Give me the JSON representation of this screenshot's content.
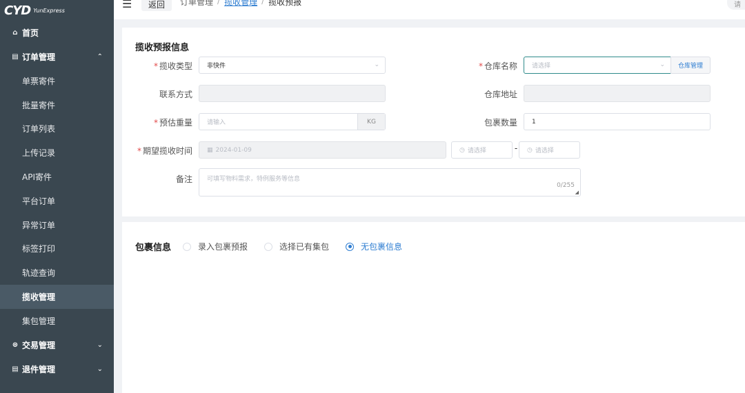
{
  "brand": {
    "logo_mark": "CYD",
    "logo_text": "YunExpress"
  },
  "sidebar": {
    "groups": [
      {
        "label": "首页",
        "icon": "home-icon",
        "glyph": "⌂"
      },
      {
        "label": "订单管理",
        "icon": "order-icon",
        "glyph": "▤",
        "chevron": "⌃"
      },
      {
        "label": "交易管理",
        "icon": "trade-icon",
        "glyph": "⊛",
        "chevron": "⌄"
      },
      {
        "label": "退件管理",
        "icon": "return-icon",
        "glyph": "▤",
        "chevron": "⌄"
      }
    ],
    "items": [
      {
        "label": "单票寄件"
      },
      {
        "label": "批量寄件"
      },
      {
        "label": "订单列表"
      },
      {
        "label": "上传记录"
      },
      {
        "label": "API寄件"
      },
      {
        "label": "平台订单"
      },
      {
        "label": "异常订单"
      },
      {
        "label": "标签打印"
      },
      {
        "label": "轨迹查询"
      },
      {
        "label": "揽收管理",
        "active": true
      },
      {
        "label": "集包管理"
      }
    ]
  },
  "header": {
    "back_label": "返回",
    "breadcrumb": [
      "订单管理",
      "揽收管理",
      "揽收预报"
    ],
    "separator": "/",
    "top_right": "请"
  },
  "pickup_section": {
    "title": "揽收预报信息",
    "required_mark": "*",
    "pickup_type": {
      "label": "揽收类型",
      "value": "非快件"
    },
    "warehouse": {
      "label": "仓库名称",
      "placeholder": "请选择",
      "manage_label": "仓库管理"
    },
    "contact": {
      "label": "联系方式",
      "value": ""
    },
    "warehouse_address": {
      "label": "仓库地址",
      "value": ""
    },
    "weight": {
      "label": "预估重量",
      "placeholder": "请输入",
      "unit": "KG"
    },
    "package_count": {
      "label": "包裹数量",
      "value": "1"
    },
    "pickup_time": {
      "label": "期望揽收时间",
      "date": "2024-01-09",
      "start_placeholder": "请选择",
      "end_placeholder": "请选择",
      "range_sep": "-"
    },
    "remark": {
      "label": "备注",
      "placeholder": "可填写物料需求，特例服务等信息",
      "counter": "0/255"
    }
  },
  "package_section": {
    "title": "包裹信息",
    "options": [
      {
        "label": "录入包裹预报",
        "checked": false
      },
      {
        "label": "选择已有集包",
        "checked": false
      },
      {
        "label": "无包裹信息",
        "checked": true
      }
    ]
  },
  "colors": {
    "sidebar_bg": "#3a4750",
    "accent": "#2e7dd1",
    "required": "#e24b4b"
  }
}
